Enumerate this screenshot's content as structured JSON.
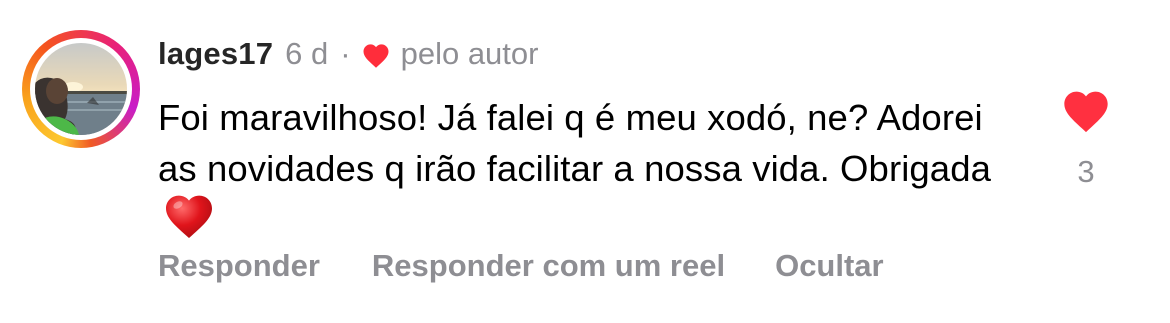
{
  "comment": {
    "username": "lages17",
    "time_ago": "6 d",
    "separator": "·",
    "liked_by_author_label": "pelo autor",
    "text": "Foi maravilhoso! Já falei q é meu xodó, ne? Adorei as novidades q irão facilitar a nossa vida. Obrigada",
    "likes_count": "3",
    "liked": true
  },
  "actions": {
    "reply_label": "Responder",
    "reply_with_reel_label": "Responder com um reel",
    "hide_label": "Ocultar"
  },
  "icons": {
    "author_like": "heart-icon",
    "text_emoji": "red-heart-emoji",
    "like_button": "heart-filled-icon"
  },
  "colors": {
    "heart_red": "#ff3040",
    "secondary_text": "#8e8e93",
    "primary_text": "#000000",
    "username": "#262626"
  }
}
